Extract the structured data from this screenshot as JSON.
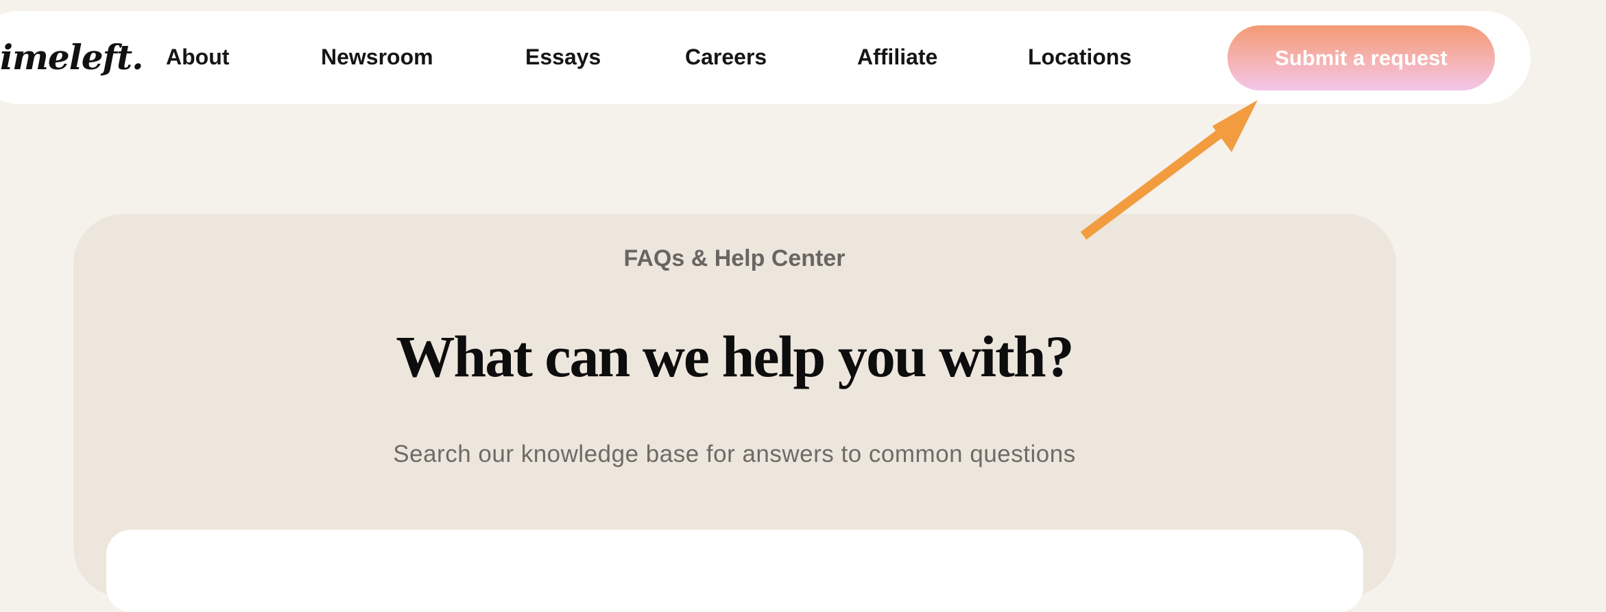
{
  "brand": {
    "logo_text": "imeleft."
  },
  "nav": {
    "items": [
      {
        "label": "About"
      },
      {
        "label": "Newsroom"
      },
      {
        "label": "Essays"
      },
      {
        "label": "Careers"
      },
      {
        "label": "Affiliate"
      },
      {
        "label": "Locations"
      }
    ],
    "cta_label": "Submit a request"
  },
  "hero": {
    "eyebrow": "FAQs & Help Center",
    "title": "What can we help you with?",
    "subtitle": "Search our knowledge base for answers to common questions"
  },
  "search": {
    "placeholder": ""
  },
  "colors": {
    "page_background": "#f5f2ec",
    "header_background": "#ffffff",
    "card_background": "#ede6dc",
    "cta_gradient_top": "#f39a75",
    "cta_gradient_bottom": "#f4c6ea",
    "annotation_arrow": "#f29c3f"
  }
}
